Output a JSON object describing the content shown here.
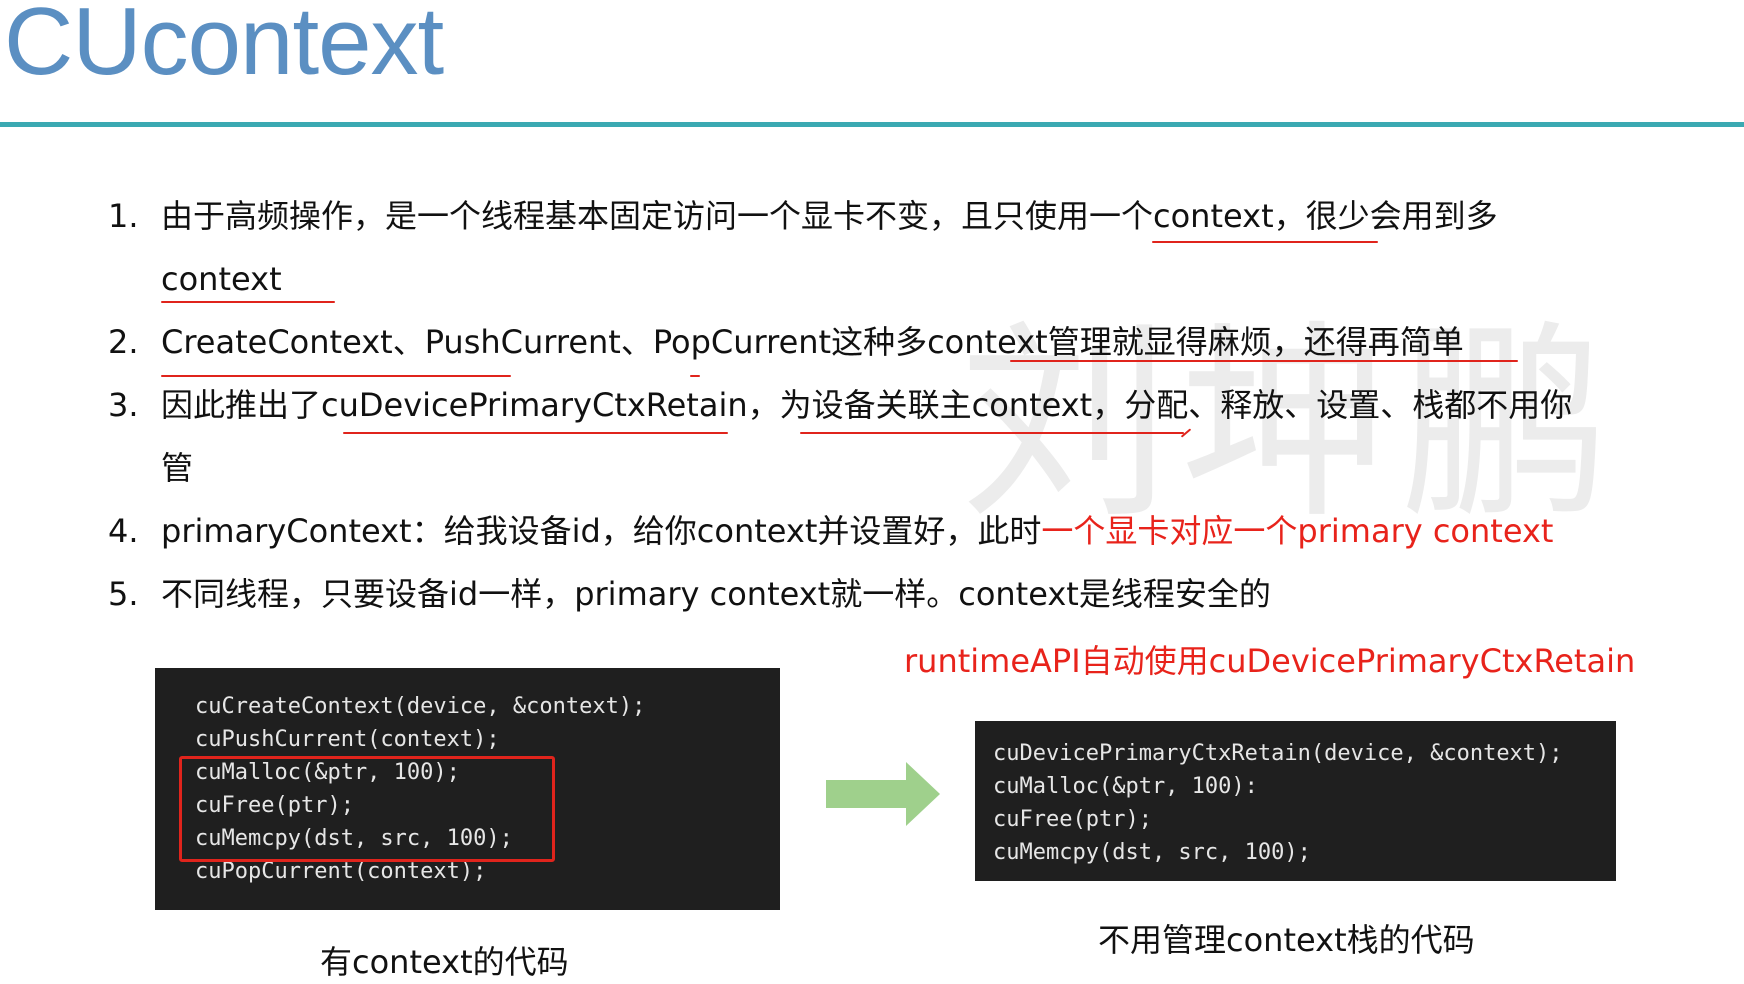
{
  "title": "CUcontext",
  "watermark": "刘坤鹏",
  "items": [
    {
      "num": "1.",
      "text_a": "由于高频操作，是一个线程基本固定访问一个显卡不变，且只使用一个context，很少会用到多",
      "text_b": "context"
    },
    {
      "num": "2.",
      "text": "CreateContext、PushCurrent、PopCurrent这种多context管理就显得麻烦，还得再简单"
    },
    {
      "num": "3.",
      "text_a": "因此推出了cuDevicePrimaryCtxRetain，为设备关联主context，分配、释放、设置、栈都不用你",
      "text_b": "管"
    },
    {
      "num": "4.",
      "text": "primaryContext：给我设备id，给你context并设置好，此时",
      "text_red": "一个显卡对应一个primary context"
    },
    {
      "num": "5.",
      "text": "不同线程，只要设备id一样，primary context就一样。context是线程安全的"
    }
  ],
  "runtime_note": "runtimeAPI自动使用cuDevicePrimaryCtxRetain",
  "code_left": [
    "cuCreateContext(device, &context);",
    "cuPushCurrent(context);",
    "cuMalloc(&ptr, 100);",
    "cuFree(ptr);",
    "cuMemcpy(dst, src, 100);",
    "cuPopCurrent(context);"
  ],
  "code_right": [
    "cuDevicePrimaryCtxRetain(device, &context);",
    "cuMalloc(&ptr, 100):",
    "cuFree(ptr);",
    "cuMemcpy(dst, src, 100);"
  ],
  "caption_left": "有context的代码",
  "caption_right": "不用管理context栈的代码",
  "colors": {
    "title": "#5b8fc2",
    "rule": "#3ba9b2",
    "accent_red": "#e8231b",
    "arrow": "#9fd08c",
    "code_bg": "#1f1f1f"
  }
}
